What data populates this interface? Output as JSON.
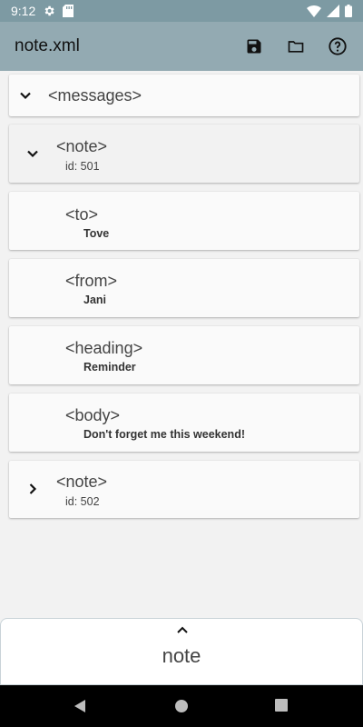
{
  "status_bar": {
    "time": "9:12",
    "icons": [
      "gear-icon",
      "sd-card-icon",
      "wifi-icon",
      "signal-icon",
      "battery-icon"
    ]
  },
  "app_bar": {
    "title": "note.xml",
    "actions": [
      "save-icon",
      "folder-icon",
      "help-icon"
    ]
  },
  "tree": {
    "nodes": [
      {
        "tag": "<messages>",
        "expanded": true
      },
      {
        "tag": "<note>",
        "attr": "id: 501",
        "expanded": true
      },
      {
        "tag": "<to>",
        "value": "Tove"
      },
      {
        "tag": "<from>",
        "value": "Jani"
      },
      {
        "tag": "<heading>",
        "value": "Reminder"
      },
      {
        "tag": "<body>",
        "value": "Don't forget me this weekend!"
      },
      {
        "tag": "<note>",
        "attr": "id: 502",
        "expanded": false
      }
    ]
  },
  "bottom_panel": {
    "title": "note"
  },
  "nav_bar": {
    "buttons": [
      "back-icon",
      "home-icon",
      "recents-icon"
    ]
  },
  "colors": {
    "status_bar": "#7d9aa3",
    "app_bar": "#93aab2",
    "background": "#f2f2f2"
  }
}
